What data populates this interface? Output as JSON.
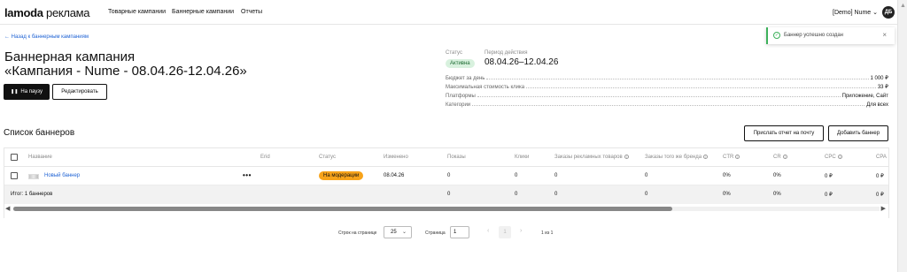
{
  "header": {
    "logo_brand": "lamoda",
    "logo_suffix": "реклама",
    "nav": [
      "Товарные кампании",
      "Баннерные кампании",
      "Отчеты"
    ],
    "account": "[Demo] Nume",
    "account_chevron": "⌄",
    "avatar_initials": "ДБ"
  },
  "toast": {
    "message": "Баннер успешно создан",
    "close": "×",
    "ok_glyph": "✓"
  },
  "back_link": "← Назад к баннерным кампаниям",
  "campaign": {
    "title_line1": "Баннерная кампания",
    "title_line2": "«Кампания - Nume - 08.04.26-12.04.26»",
    "pause_label": "На паузу",
    "pause_glyph": "❚❚",
    "edit_label": "Редактировать",
    "status_label": "Статус",
    "status_value": "Активна",
    "period_label": "Период действия",
    "period_value": "08.04.26–12.04.26",
    "details": [
      {
        "key": "Бюджет за день",
        "value": "1 000 ₽"
      },
      {
        "key": "Максимальная стоимость клика",
        "value": "33 ₽"
      },
      {
        "key": "Платформы",
        "value": "Приложение, Сайт"
      },
      {
        "key": "Категории",
        "value": "Для всех"
      }
    ]
  },
  "banners": {
    "title": "Список баннеров",
    "send_report_label": "Прислать отчет на почту",
    "add_banner_label": "Добавить баннер",
    "columns": [
      "Название",
      "Erid",
      "Статус",
      "Изменено",
      "Показы",
      "Клики",
      "Заказы рекламных товаров",
      "Заказы того же бренда",
      "CTR",
      "CR",
      "CPC",
      "CPA"
    ],
    "info_glyph": "i",
    "row": {
      "name": "Новый баннер",
      "menu": "•••",
      "status": "На модерации",
      "changed": "08.04.26",
      "shows": "0",
      "clicks": "0",
      "orders_ad": "0",
      "orders_brand": "0",
      "ctr": "0%",
      "cr": "0%",
      "cpc": "0 ₽",
      "cpa": "0 ₽"
    },
    "total": {
      "label": "Итог: 1 баннеров",
      "shows": "0",
      "clicks": "0",
      "orders_ad": "0",
      "orders_brand": "0",
      "ctr": "0%",
      "cr": "0%",
      "cpc": "0 ₽",
      "cpa": "0 ₽"
    },
    "scroll_left": "◀",
    "scroll_right": "▶"
  },
  "pagination": {
    "rows_label": "Строк на странице",
    "rows_value": "25",
    "page_label": "Страница",
    "page_value": "1",
    "prev": "‹",
    "current": "1",
    "next": "›",
    "range": "1 из 1",
    "chevron": "⌄"
  },
  "colors": {
    "accent_link": "#1f63d4",
    "status_active_bg": "#d8f1de",
    "moderation_badge": "#f7a31a",
    "toast_success": "#3db15b"
  },
  "icons": [
    "check-circle-icon",
    "close-icon",
    "pause-icon",
    "info-icon",
    "chevron-down-icon",
    "arrow-left-icon"
  ]
}
